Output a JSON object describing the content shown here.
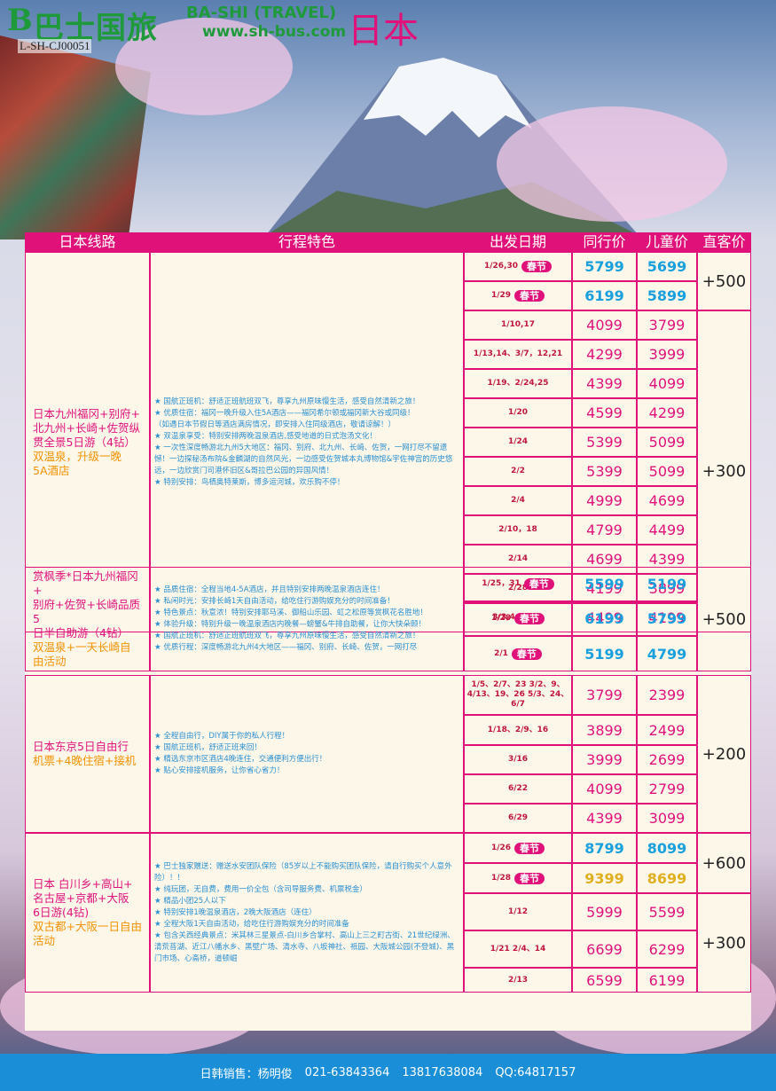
{
  "header": {
    "logo_mark": "B",
    "logo_cn": "巴士国旅",
    "logo_en": "BA-SHI (TRAVEL)",
    "website": "www.sh-bus.com",
    "title": "日本",
    "license": "L-SH-CJ00051"
  },
  "columns": [
    "日本线路",
    "行程特色",
    "出发日期",
    "同行价",
    "儿童价",
    "直客价"
  ],
  "spring_tag": "春节",
  "groups": [
    {
      "route_lines": [
        "日本九州福冈+别府+",
        "北九州+长崎+佐贺纵",
        "贯全景5日游（4钻）"
      ],
      "route_sub": [
        "双温泉，升级一晚",
        "5A酒店"
      ],
      "features": [
        "★ 国航正班机：舒适正班航班双飞，尊享九州原味慢生活，感受自然清新之旅！",
        "★ 优质住宿：福冈一晚升级入住5A酒店——福冈希尔顿或福冈新大谷或同级！",
        "（如遇日本节假日等酒店满房情况，即安排入住同级酒店，敬请谅解！）",
        "★ 双温泉享受：特别安排两晚温泉酒店,感受地道的日式泡汤文化！",
        "★ 一次性深度畅游北九州5大地区：福冈、别府、北九州、长崎、佐贺，一网打尽不留遗憾！一边探秘汤布院&金麟湖的自然风光，一边感受佐贺城本丸博物馆&宇佐神宫的历史悠远，一边欣赏门司港怀旧区&哥拉巴公园的异国风情！",
        "★ 特别安排：鸟栖奥特莱斯，博多运河城，欢乐购不停！"
      ],
      "rows": [
        {
          "date": "1/26,30",
          "spring": true,
          "peer": "5799",
          "child": "5699"
        },
        {
          "date": "1/29",
          "spring": true,
          "peer": "6199",
          "child": "5899"
        },
        {
          "date": "1/10,17",
          "spring": false,
          "peer": "4099",
          "child": "3799"
        },
        {
          "date": "1/13,14、3/7，12,21",
          "spring": false,
          "peer": "4299",
          "child": "3999"
        },
        {
          "date": "1/19、2/24,25",
          "spring": false,
          "peer": "4399",
          "child": "4099"
        },
        {
          "date": "1/20",
          "spring": false,
          "peer": "4599",
          "child": "4299"
        },
        {
          "date": "1/24",
          "spring": false,
          "peer": "5399",
          "child": "5099"
        },
        {
          "date": "2/2",
          "spring": false,
          "peer": "5399",
          "child": "5099"
        },
        {
          "date": "2/4",
          "spring": false,
          "peer": "4999",
          "child": "4699"
        },
        {
          "date": "2/10，18",
          "spring": false,
          "peer": "4799",
          "child": "4499"
        },
        {
          "date": "2/14",
          "spring": false,
          "peer": "4699",
          "child": "4399"
        },
        {
          "date": "2/28",
          "spring": false,
          "peer": "4199",
          "child": "3899"
        },
        {
          "date": "3/3,4,10,11",
          "spring": false,
          "peer": "4499",
          "child": "4199"
        }
      ],
      "direct": [
        "+500",
        "+300"
      ]
    },
    {
      "route_lines": [
        "赏枫季*日本九州福冈+",
        "别府+佐贺+长崎品质5",
        "日半自助游（4钻）"
      ],
      "route_sub": [
        "双温泉+一天长崎自",
        "由活动"
      ],
      "features": [
        "★ 品质住宿：全程当地4-5A酒店，并且特别安排两晚温泉酒店连住！",
        "★ 私闲时光：安排长崎1天自由活动，给吃住行游购娱充分的时间准备！",
        "★ 特色景点：秋意浓！特别安排耶马溪、御船山乐园、虹之松原等赏枫花名胜地！",
        "★ 体验升级：特别升级一晚温泉酒店内晚餐—螃蟹&牛排自助餐，让你大快朵颐！",
        "★ 国航正班机：舒适正班航班双飞，尊享九州原味慢生活，感受自然清新之旅！",
        "★ 优质行程：深度畅游北九州4大地区——福冈、别府、长崎、佐贺，一网打尽"
      ],
      "rows": [
        {
          "date": "1/25，31",
          "spring": true,
          "peer": "5599",
          "child": "5199"
        },
        {
          "date": "1/28",
          "spring": true,
          "peer": "6199",
          "child": "5799"
        },
        {
          "date": "2/1",
          "spring": true,
          "peer": "5199",
          "child": "4799"
        }
      ],
      "direct": [
        "+500"
      ]
    },
    {
      "route_lines": [
        "日本东京5日自由行"
      ],
      "route_sub": [
        "机票+4晚住宿+接机"
      ],
      "features": [
        "★ 全程自由行，DIY属于你的私人行程！",
        "★ 国航正班机，舒适正班来回！",
        "★ 精选东京市区酒店4晚连住，交通便利方便出行！",
        "★ 贴心安排接机服务，让你省心省力！"
      ],
      "rows": [
        {
          "date": "1/5、2/7、23 3/2、9、4/13、19、26 5/3、24、6/7",
          "spring": false,
          "peer": "3799",
          "child": "2399"
        },
        {
          "date": "1/18、2/9、16",
          "spring": false,
          "peer": "3899",
          "child": "2499"
        },
        {
          "date": "3/16",
          "spring": false,
          "peer": "3999",
          "child": "2699"
        },
        {
          "date": "6/22",
          "spring": false,
          "peer": "4099",
          "child": "2799"
        },
        {
          "date": "6/29",
          "spring": false,
          "peer": "4399",
          "child": "3099"
        }
      ],
      "direct": [
        "+200"
      ]
    },
    {
      "route_lines": [
        "日本 白川乡+高山+",
        "名古屋+京都+大阪",
        "6日游(4钻)"
      ],
      "route_sub": [
        "双古都+大阪一日自由活动"
      ],
      "features": [
        "★ 巴士独家赠送：赠送水安团队保险（85岁以上不能购买团队保险，请自行购买个人意外险）！！",
        "★ 纯玩团，无自费，费用一价全包（含司导服务费、机票税金）",
        "★ 精品小团25人以下",
        "★ 特别安排1晚温泉酒店，2晚大阪酒店（连住）",
        "★ 全程大阪1天自由活动，给吃住行游购娱充分的时间准备",
        "★ 包含关西经典景点：米其林三星景点-白川乡合掌村、高山上三之町古街、21世纪绿洲、清荒菩湖、近江八幡水乡、黑壁广场、清水寺、八坂神社、祇园、大阪城公园(不登城)、黑门市场、心斋桥，道顿崛"
      ],
      "rows": [
        {
          "date": "1/26",
          "spring": true,
          "peer": "8799",
          "child": "8099"
        },
        {
          "date": "1/28",
          "spring": true,
          "peer": "9399",
          "child": "8699"
        },
        {
          "date": "1/12",
          "spring": false,
          "peer": "5999",
          "child": "5599"
        },
        {
          "date": "1/21 2/4、14",
          "spring": false,
          "peer": "6699",
          "child": "6299"
        },
        {
          "date": "2/13",
          "spring": false,
          "peer": "6599",
          "child": "6199"
        }
      ],
      "direct": [
        "+600",
        "+300"
      ]
    }
  ],
  "footer": {
    "label": "日韩销售：",
    "name": "杨明俊",
    "phone1": "021-63843364",
    "phone2": "13817638084",
    "qq": "QQ:64817157"
  }
}
